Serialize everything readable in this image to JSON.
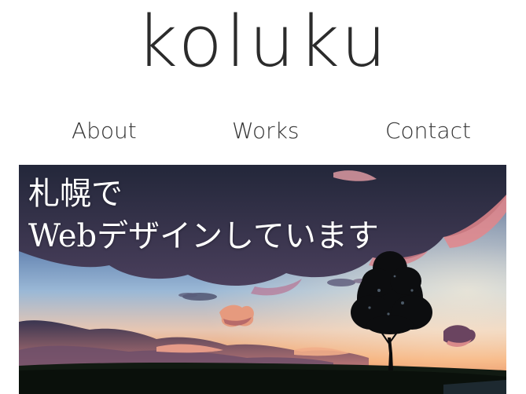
{
  "site": {
    "logo": "koluku"
  },
  "nav": {
    "items": [
      {
        "label": "About"
      },
      {
        "label": "Works"
      },
      {
        "label": "Contact"
      }
    ]
  },
  "hero": {
    "headline_line1": "札幌で",
    "headline_line2": "Webデザインしています",
    "image_description_icon": "sunset-tree-photo"
  },
  "colors": {
    "text": "#2f2f2f",
    "hero_text": "#ffffff",
    "sky_top": "#3e5f8c",
    "sky_horizon": "#f2a36a",
    "cloud_dark": "#2a2a40",
    "cloud_pink": "#e98a7a"
  }
}
